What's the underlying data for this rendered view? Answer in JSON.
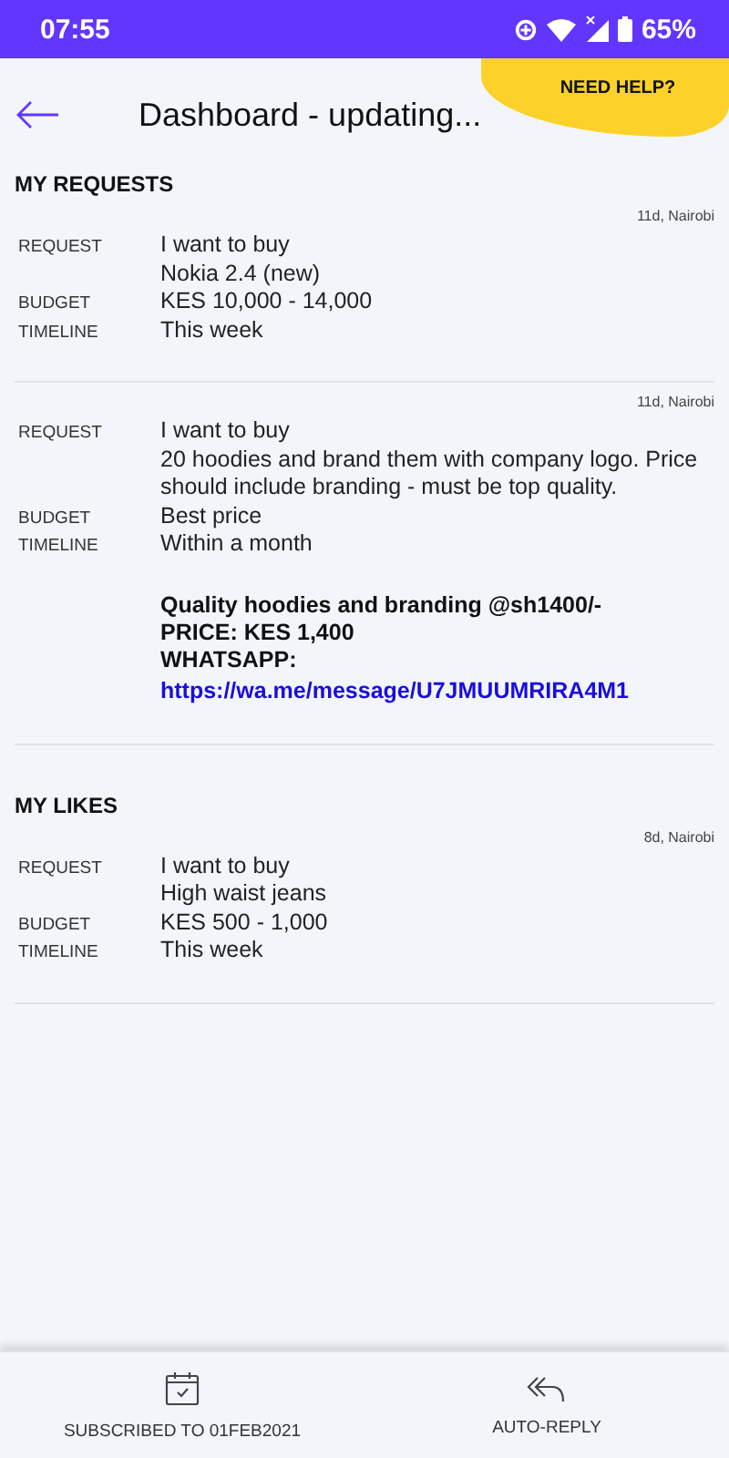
{
  "status_bar": {
    "time": "07:55",
    "battery": "65%"
  },
  "header": {
    "title": "Dashboard - updating...",
    "help": "NEED HELP?"
  },
  "sections": [
    {
      "title": "MY REQUESTS",
      "items": [
        {
          "meta": "11d, Nairobi",
          "fields": [
            {
              "label": "REQUEST",
              "lines": [
                "I want to buy",
                "Nokia 2.4 (new)"
              ]
            },
            {
              "label": "BUDGET",
              "lines": [
                "KES 10,000 - 14,000"
              ]
            },
            {
              "label": "TIMELINE",
              "lines": [
                "This week"
              ]
            }
          ]
        },
        {
          "meta": "11d, Nairobi",
          "fields": [
            {
              "label": "REQUEST",
              "lines": [
                "I want to buy",
                "20 hoodies and brand them with company logo. Price should include branding - must be top quality."
              ]
            },
            {
              "label": "BUDGET",
              "lines": [
                "Best price"
              ]
            },
            {
              "label": "TIMELINE",
              "lines": [
                "Within a month"
              ]
            }
          ],
          "offer": {
            "lines": [
              "Quality hoodies and branding @sh1400/-",
              "PRICE: KES 1,400",
              "WHATSAPP:"
            ],
            "link": "https://wa.me/message/U7JMUUMRIRA4M1"
          }
        }
      ]
    },
    {
      "title": "MY LIKES",
      "items": [
        {
          "meta": "8d, Nairobi",
          "fields": [
            {
              "label": "REQUEST",
              "lines": [
                "I want to buy",
                "High waist jeans"
              ]
            },
            {
              "label": "BUDGET",
              "lines": [
                "KES 500 - 1,000"
              ]
            },
            {
              "label": "TIMELINE",
              "lines": [
                "This week"
              ]
            }
          ]
        }
      ]
    }
  ],
  "bottom_nav": [
    {
      "kind": "calendar",
      "label": "SUBSCRIBED TO 01FEB2021"
    },
    {
      "kind": "reply",
      "label": "AUTO-REPLY"
    }
  ]
}
